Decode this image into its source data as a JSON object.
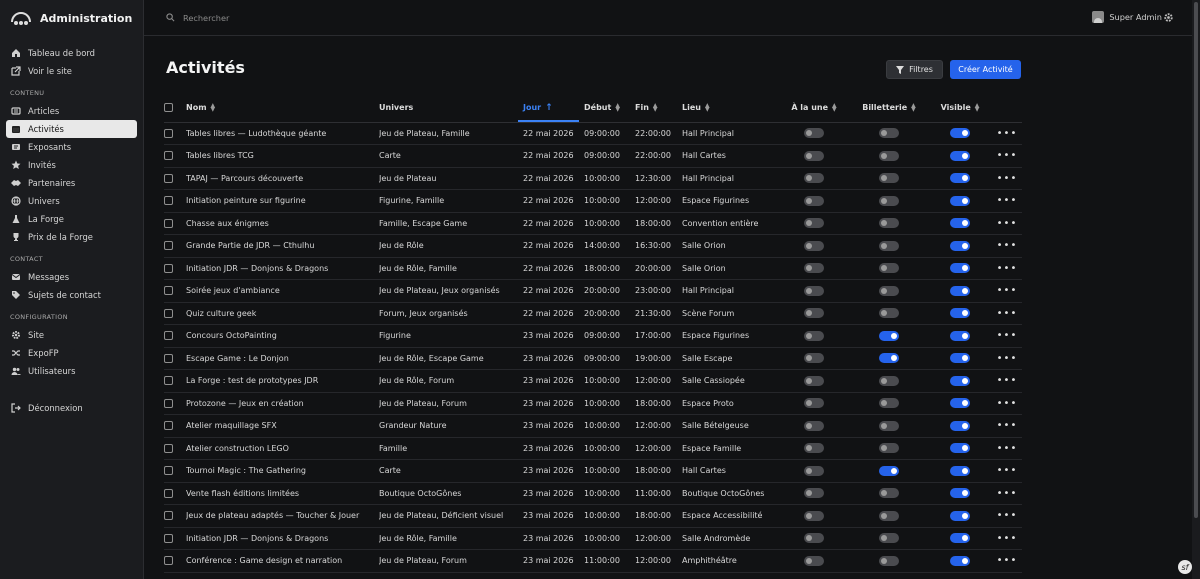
{
  "brand": {
    "title": "Administration"
  },
  "sidebar": {
    "top": [
      {
        "label": "Tableau de bord",
        "icon": "home-icon"
      },
      {
        "label": "Voir le site",
        "icon": "external-link-icon"
      }
    ],
    "sections": [
      {
        "title": "CONTENU",
        "items": [
          {
            "label": "Articles",
            "icon": "newspaper-icon"
          },
          {
            "label": "Activités",
            "icon": "calendar-icon",
            "active": true
          },
          {
            "label": "Exposants",
            "icon": "id-card-icon"
          },
          {
            "label": "Invités",
            "icon": "star-icon"
          },
          {
            "label": "Partenaires",
            "icon": "handshake-icon"
          },
          {
            "label": "Univers",
            "icon": "globe-icon"
          },
          {
            "label": "La Forge",
            "icon": "flask-icon"
          },
          {
            "label": "Prix de la Forge",
            "icon": "trophy-icon"
          }
        ]
      },
      {
        "title": "CONTACT",
        "items": [
          {
            "label": "Messages",
            "icon": "envelope-icon"
          },
          {
            "label": "Sujets de contact",
            "icon": "tag-icon"
          }
        ]
      },
      {
        "title": "CONFIGURATION",
        "items": [
          {
            "label": "Site",
            "icon": "gear-icon"
          },
          {
            "label": "ExpoFP",
            "icon": "shuffle-icon"
          },
          {
            "label": "Utilisateurs",
            "icon": "users-icon"
          }
        ]
      }
    ],
    "logout": {
      "label": "Déconnexion",
      "icon": "logout-icon"
    }
  },
  "topbar": {
    "search_placeholder": "Rechercher",
    "user_name": "Super Admin"
  },
  "page": {
    "title": "Activités",
    "filter_label": "Filtres",
    "create_label": "Créer Activité"
  },
  "table": {
    "columns": {
      "name": "Nom",
      "universe": "Univers",
      "day": "Jour",
      "start": "Début",
      "end": "Fin",
      "place": "Lieu",
      "featured": "À la une",
      "ticketing": "Billetterie",
      "visible": "Visible"
    },
    "rows": [
      {
        "name": "Tables libres — Ludothèque géante",
        "universe": "Jeu de Plateau, Famille",
        "day": "22 mai 2026",
        "start": "09:00:00",
        "end": "22:00:00",
        "place": "Hall Principal",
        "featured": false,
        "ticketing": false,
        "visible": true
      },
      {
        "name": "Tables libres TCG",
        "universe": "Carte",
        "day": "22 mai 2026",
        "start": "09:00:00",
        "end": "22:00:00",
        "place": "Hall Cartes",
        "featured": false,
        "ticketing": false,
        "visible": true
      },
      {
        "name": "TAPAJ — Parcours découverte",
        "universe": "Jeu de Plateau",
        "day": "22 mai 2026",
        "start": "10:00:00",
        "end": "12:30:00",
        "place": "Hall Principal",
        "featured": false,
        "ticketing": false,
        "visible": true
      },
      {
        "name": "Initiation peinture sur figurine",
        "universe": "Figurine, Famille",
        "day": "22 mai 2026",
        "start": "10:00:00",
        "end": "12:00:00",
        "place": "Espace Figurines",
        "featured": false,
        "ticketing": false,
        "visible": true
      },
      {
        "name": "Chasse aux énigmes",
        "universe": "Famille, Escape Game",
        "day": "22 mai 2026",
        "start": "10:00:00",
        "end": "18:00:00",
        "place": "Convention entière",
        "featured": false,
        "ticketing": false,
        "visible": true
      },
      {
        "name": "Grande Partie de JDR — Cthulhu",
        "universe": "Jeu de Rôle",
        "day": "22 mai 2026",
        "start": "14:00:00",
        "end": "16:30:00",
        "place": "Salle Orion",
        "featured": false,
        "ticketing": false,
        "visible": true
      },
      {
        "name": "Initiation JDR — Donjons & Dragons",
        "universe": "Jeu de Rôle, Famille",
        "day": "22 mai 2026",
        "start": "18:00:00",
        "end": "20:00:00",
        "place": "Salle Orion",
        "featured": false,
        "ticketing": false,
        "visible": true
      },
      {
        "name": "Soirée jeux d'ambiance",
        "universe": "Jeu de Plateau, Jeux organisés",
        "day": "22 mai 2026",
        "start": "20:00:00",
        "end": "23:00:00",
        "place": "Hall Principal",
        "featured": false,
        "ticketing": false,
        "visible": true
      },
      {
        "name": "Quiz culture geek",
        "universe": "Forum, Jeux organisés",
        "day": "22 mai 2026",
        "start": "20:00:00",
        "end": "21:30:00",
        "place": "Scène Forum",
        "featured": false,
        "ticketing": false,
        "visible": true
      },
      {
        "name": "Concours OctoPainting",
        "universe": "Figurine",
        "day": "23 mai 2026",
        "start": "09:00:00",
        "end": "17:00:00",
        "place": "Espace Figurines",
        "featured": false,
        "ticketing": true,
        "visible": true
      },
      {
        "name": "Escape Game : Le Donjon",
        "universe": "Jeu de Rôle, Escape Game",
        "day": "23 mai 2026",
        "start": "09:00:00",
        "end": "19:00:00",
        "place": "Salle Escape",
        "featured": false,
        "ticketing": true,
        "visible": true
      },
      {
        "name": "La Forge : test de prototypes JDR",
        "universe": "Jeu de Rôle, Forum",
        "day": "23 mai 2026",
        "start": "10:00:00",
        "end": "12:00:00",
        "place": "Salle Cassiopée",
        "featured": false,
        "ticketing": false,
        "visible": true
      },
      {
        "name": "Protozone — Jeux en création",
        "universe": "Jeu de Plateau, Forum",
        "day": "23 mai 2026",
        "start": "10:00:00",
        "end": "18:00:00",
        "place": "Espace Proto",
        "featured": false,
        "ticketing": false,
        "visible": true
      },
      {
        "name": "Atelier maquillage SFX",
        "universe": "Grandeur Nature",
        "day": "23 mai 2026",
        "start": "10:00:00",
        "end": "12:00:00",
        "place": "Salle Bételgeuse",
        "featured": false,
        "ticketing": false,
        "visible": true
      },
      {
        "name": "Atelier construction LEGO",
        "universe": "Famille",
        "day": "23 mai 2026",
        "start": "10:00:00",
        "end": "12:00:00",
        "place": "Espace Famille",
        "featured": false,
        "ticketing": false,
        "visible": true
      },
      {
        "name": "Tournoi Magic : The Gathering",
        "universe": "Carte",
        "day": "23 mai 2026",
        "start": "10:00:00",
        "end": "18:00:00",
        "place": "Hall Cartes",
        "featured": false,
        "ticketing": true,
        "visible": true
      },
      {
        "name": "Vente flash éditions limitées",
        "universe": "Boutique OctoGônes",
        "day": "23 mai 2026",
        "start": "10:00:00",
        "end": "11:00:00",
        "place": "Boutique OctoGônes",
        "featured": false,
        "ticketing": false,
        "visible": true
      },
      {
        "name": "Jeux de plateau adaptés — Toucher & Jouer",
        "universe": "Jeu de Plateau, Déficient visuel",
        "day": "23 mai 2026",
        "start": "10:00:00",
        "end": "18:00:00",
        "place": "Espace Accessibilité",
        "featured": false,
        "ticketing": false,
        "visible": true
      },
      {
        "name": "Initiation JDR — Donjons & Dragons",
        "universe": "Jeu de Rôle, Famille",
        "day": "23 mai 2026",
        "start": "10:00:00",
        "end": "12:00:00",
        "place": "Salle Andromède",
        "featured": false,
        "ticketing": false,
        "visible": true
      },
      {
        "name": "Conférence : Game design et narration",
        "universe": "Jeu de Plateau, Forum",
        "day": "23 mai 2026",
        "start": "11:00:00",
        "end": "12:00:00",
        "place": "Amphithéâtre",
        "featured": false,
        "ticketing": false,
        "visible": true
      }
    ]
  },
  "colors": {
    "accent": "#2563eb",
    "background": "#111214",
    "sidebar": "#1b1c1f"
  }
}
